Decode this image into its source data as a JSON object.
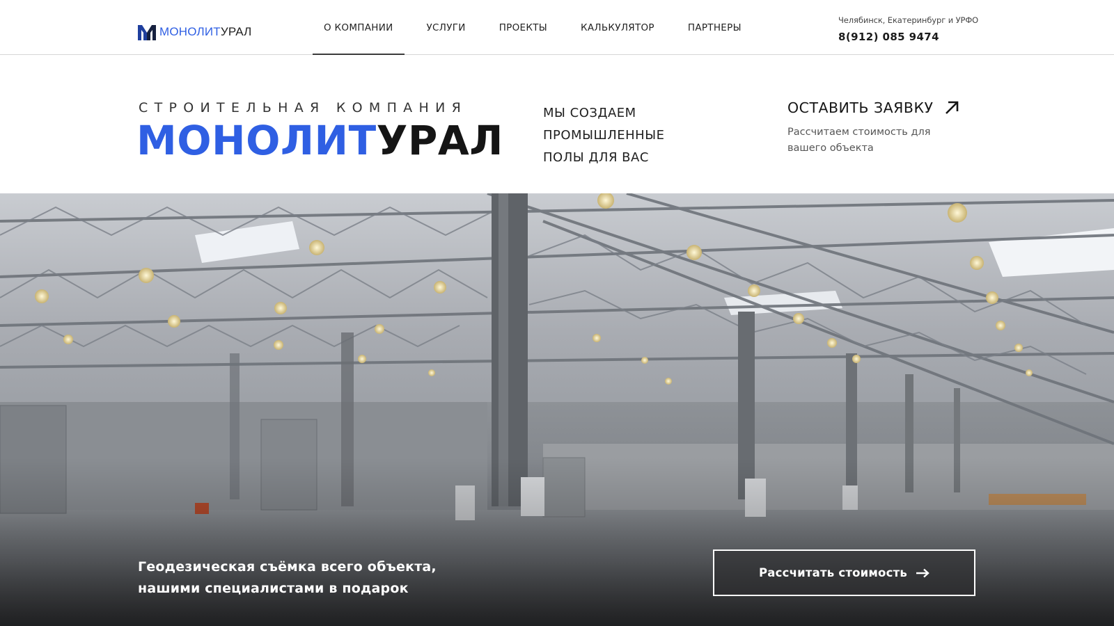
{
  "header": {
    "logo": {
      "part_blue": "МОНОЛИТ",
      "part_dark": "УРАЛ"
    },
    "nav": [
      {
        "label": "О КОМПАНИИ",
        "active": true
      },
      {
        "label": "УСЛУГИ",
        "active": false
      },
      {
        "label": "ПРОЕКТЫ",
        "active": false
      },
      {
        "label": "КАЛЬКУЛЯТОР",
        "active": false
      },
      {
        "label": "ПАРТНЕРЫ",
        "active": false
      }
    ],
    "region": "Челябинск, Екатеринбург и УРФО",
    "phone": "8(912) 085 9474"
  },
  "intro": {
    "subtitle": "СТРОИТЕЛЬНАЯ КОМПАНИЯ",
    "brand_blue": "МОНОЛИТ",
    "brand_dark": "УРАЛ",
    "slogan": [
      "МЫ СОЗДАЕМ",
      "ПРОМЫШЛЕННЫЕ",
      "ПОЛЫ ДЛЯ ВАС"
    ],
    "request_label": "ОСТАВИТЬ ЗАЯВКУ",
    "request_note": "Рассчитаем стоимость для вашего объекта",
    "request_icon": "arrow-up-right-icon"
  },
  "hero": {
    "promo_lines": [
      "Геодезическая съёмка всего объекта,",
      "нашими специалистами в подарок"
    ],
    "cta_label": "Рассчитать стоимость",
    "cta_icon": "arrow-right-icon"
  },
  "colors": {
    "accent": "#2f5fe3",
    "text_dark": "#1c1c1c",
    "hero_overlay": "#2a2a2c"
  }
}
